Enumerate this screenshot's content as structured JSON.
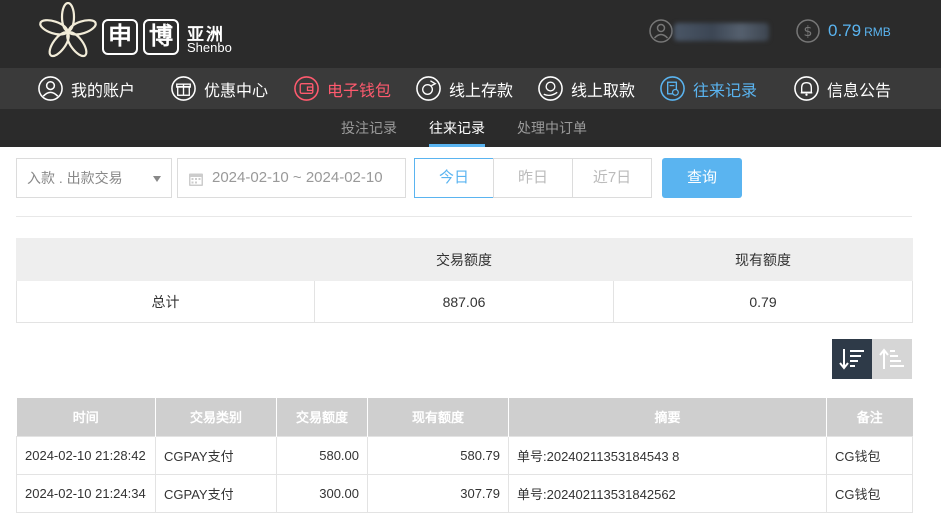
{
  "brand": {
    "char1": "申",
    "char2": "博",
    "cn": "亚洲",
    "en": "Shenbo"
  },
  "account": {
    "balance": "0.79",
    "currency": "RMB"
  },
  "mainnav": [
    {
      "label": "我的账户",
      "icon": "user-circle-icon"
    },
    {
      "label": "优惠中心",
      "icon": "gift-icon"
    },
    {
      "label": "电子钱包",
      "icon": "wallet-icon"
    },
    {
      "label": "线上存款",
      "icon": "deposit-icon"
    },
    {
      "label": "线上取款",
      "icon": "withdraw-icon"
    },
    {
      "label": "往来记录",
      "icon": "records-icon"
    },
    {
      "label": "信息公告",
      "icon": "bell-icon"
    }
  ],
  "subnav": [
    {
      "label": "投注记录"
    },
    {
      "label": "往来记录"
    },
    {
      "label": "处理中订单"
    }
  ],
  "filters": {
    "type_select": "入款 . 出款交易",
    "date_range": "2024-02-10 ~ 2024-02-10",
    "quick": [
      "今日",
      "昨日",
      "近7日"
    ],
    "query_label": "查询"
  },
  "summary": {
    "headers": [
      "",
      "交易额度",
      "现有额度"
    ],
    "total_label": "总计",
    "total_amount": "887.06",
    "current_amount": "0.79"
  },
  "records": {
    "headers": [
      "时间",
      "交易类别",
      "交易额度",
      "现有额度",
      "摘要",
      "备注"
    ],
    "rows": [
      {
        "time": "2024-02-10 21:28:42",
        "category": "CGPAY支付",
        "amount": "580.00",
        "balance": "580.79",
        "summary": "单号:20240211353184543 8",
        "note": "CG钱包"
      },
      {
        "time": "2024-02-10 21:24:34",
        "category": "CGPAY支付",
        "amount": "300.00",
        "balance": "307.79",
        "summary": "单号:202402113531842562",
        "note": "CG钱包"
      }
    ]
  },
  "colors": {
    "accent": "#5ab4f0",
    "wallet_red": "#ff5a6e",
    "header_bg": "#2b2b2b",
    "nav_bg": "#3a3a3a"
  }
}
